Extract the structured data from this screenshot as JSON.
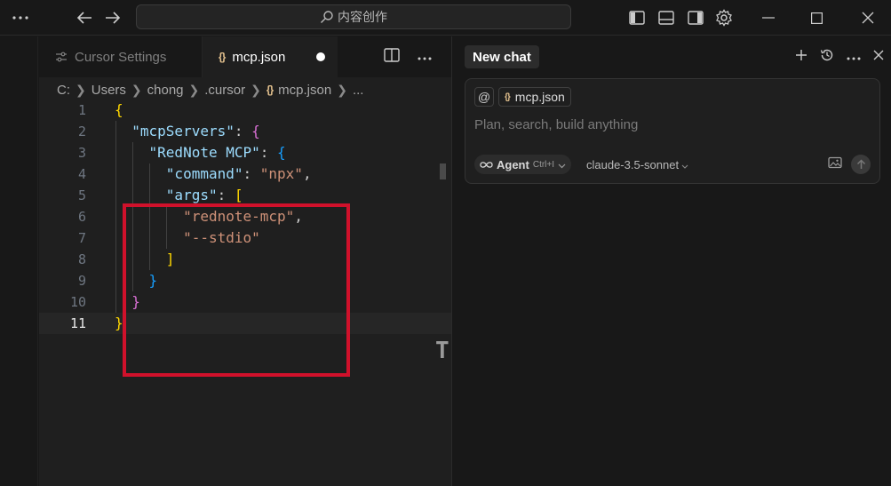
{
  "titlebar": {
    "search_text": "内容创作",
    "icons": [
      "more-icon",
      "back-arrow-icon",
      "forward-arrow-icon",
      "toggle-primary-sidebar-icon",
      "toggle-panel-icon",
      "toggle-secondary-sidebar-icon",
      "settings-gear-icon",
      "minimize-icon",
      "maximize-icon",
      "close-icon"
    ]
  },
  "tabs": [
    {
      "label": "Cursor Settings",
      "active": false,
      "icon": "settings-sliders-icon"
    },
    {
      "label": "mcp.json",
      "active": true,
      "icon": "json-braces-icon",
      "dirty": true
    }
  ],
  "breadcrumb": [
    "C:",
    "Users",
    "chong",
    ".cursor",
    "mcp.json",
    "..."
  ],
  "editor": {
    "line_numbers": [
      "1",
      "2",
      "3",
      "4",
      "5",
      "6",
      "7",
      "8",
      "9",
      "10",
      "11"
    ],
    "current_line": 11,
    "tokens": {
      "l1_open": "{",
      "l2_key": "\"mcpServers\"",
      "l2_colon": ": ",
      "l2_open": "{",
      "l3_key": "\"RedNote MCP\"",
      "l3_colon": ": ",
      "l3_open": "{",
      "l4_key": "\"command\"",
      "l4_colon": ": ",
      "l4_val": "\"npx\"",
      "l4_comma": ",",
      "l5_key": "\"args\"",
      "l5_colon": ": ",
      "l5_open": "[",
      "l6_val": "\"rednote-mcp\"",
      "l6_comma": ",",
      "l7_val": "\"--stdio\"",
      "l8_close": "]",
      "l9_close": "}",
      "l10_close": "}",
      "l11_close": "}"
    },
    "colors": {
      "highlight_box": "#d0112b"
    }
  },
  "chat": {
    "title": "New chat",
    "context_chip": "mcp.json",
    "at_symbol": "@",
    "placeholder": "Plan, search, build anything",
    "mode_label": "Agent",
    "mode_shortcut": "Ctrl+I",
    "model": "claude-3.5-sonnet"
  }
}
